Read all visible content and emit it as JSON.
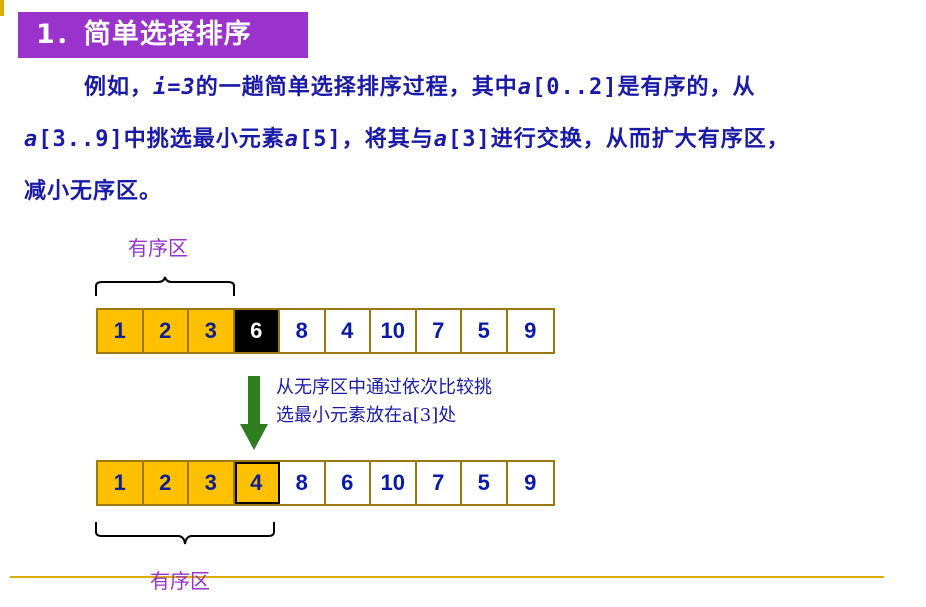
{
  "title": "1．简单选择排序",
  "paragraph": {
    "line1": {
      "t1": "例如，",
      "code1": "i=3",
      "t2": "的一趟简单选择排序过程，其中",
      "code2a": "a",
      "code2b": "[0..2]",
      "t3": "是有序的，从"
    },
    "line2": {
      "code1a": "a",
      "code1b": "[3..9]",
      "t1": "中挑选最小元素",
      "code2a": "a",
      "code2b": "[5]",
      "t2": "，将其与",
      "code3a": "a",
      "code3b": "[3]",
      "t3": "进行交换，从而扩大有序区，"
    },
    "line3": "减小无序区。"
  },
  "top_label": "有序区",
  "bottom_label": "有序区",
  "array_before": [
    "1",
    "2",
    "3",
    "6",
    "8",
    "4",
    "10",
    "7",
    "5",
    "9"
  ],
  "array_after": [
    "1",
    "2",
    "3",
    "4",
    "8",
    "6",
    "10",
    "7",
    "5",
    "9"
  ],
  "caption": {
    "line1": "从无序区中通过依次比较挑",
    "line2": "选最小元素放在a[3]处"
  },
  "colors": {
    "title_bg": "#9933cc",
    "text_blue": "#1a1aa8",
    "label_purple": "#9933cc",
    "sorted_cell": "#ffc000",
    "current_cell": "#000000",
    "arrow_green": "#2e7d1e",
    "cell_border": "#9a7a10",
    "footer_line": "#d8b000"
  }
}
